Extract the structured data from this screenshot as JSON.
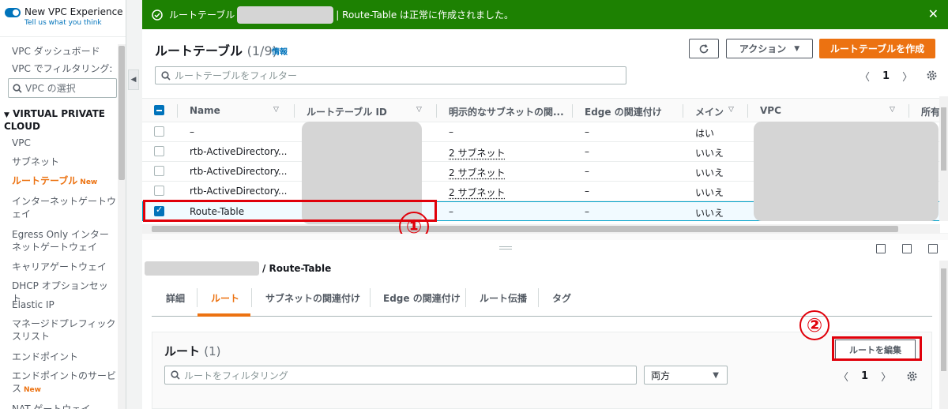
{
  "sidebar": {
    "new_vpc_title": "New VPC Experience",
    "new_vpc_link": "Tell us what you think",
    "dashboard": "VPC ダッシュボード",
    "filter_label": "VPC でフィルタリング:",
    "filter_placeholder": "VPC の選択",
    "section_title": "VIRTUAL PRIVATE CLOUD",
    "items": [
      {
        "label": "VPC"
      },
      {
        "label": "サブネット"
      },
      {
        "label": "ルートテーブル",
        "badge": "New"
      },
      {
        "label": "インターネットゲートウェイ"
      },
      {
        "label": "Egress Only インターネットゲートウェイ"
      },
      {
        "label": "キャリアゲートウェイ"
      },
      {
        "label": "DHCP オプションセット"
      },
      {
        "label": "Elastic IP"
      },
      {
        "label": "マネージドプレフィックスリスト"
      },
      {
        "label": "エンドポイント"
      },
      {
        "label": "エンドポイントのサービス",
        "badge": "New"
      },
      {
        "label": "NAT ゲートウェイ"
      }
    ]
  },
  "banner": {
    "prefix": "ルートテーブル",
    "suffix": "| Route-Table は正常に作成されました。"
  },
  "header": {
    "title": "ルートテーブル",
    "count": "(1/9)",
    "info": "情報",
    "actions_label": "アクション",
    "create_label": "ルートテーブルを作成",
    "filter_placeholder": "ルートテーブルをフィルター",
    "page": "1"
  },
  "table": {
    "columns": [
      "Name",
      "ルートテーブル ID",
      "明示的なサブネットの関...",
      "Edge の関連付け",
      "メイン",
      "VPC",
      "所有"
    ],
    "rows": [
      {
        "name": "–",
        "subnet": "–",
        "edge": "–",
        "main": "はい",
        "selected": false
      },
      {
        "name": "rtb-ActiveDirectory...",
        "subnet": "2 サブネット",
        "edge": "–",
        "main": "いいえ",
        "selected": false
      },
      {
        "name": "rtb-ActiveDirectory...",
        "subnet": "2 サブネット",
        "edge": "–",
        "main": "いいえ",
        "selected": false
      },
      {
        "name": "rtb-ActiveDirectory...",
        "subnet": "2 サブネット",
        "edge": "–",
        "main": "いいえ",
        "selected": false
      },
      {
        "name": "Route-Table",
        "subnet": "–",
        "edge": "–",
        "main": "いいえ",
        "selected": true
      }
    ]
  },
  "detail": {
    "breadcrumb": "/ Route-Table",
    "tabs": [
      "詳細",
      "ルート",
      "サブネットの関連付け",
      "Edge の関連付け",
      "ルート伝播",
      "タグ"
    ],
    "routes_title": "ルート",
    "routes_count": "(1)",
    "edit_label": "ルートを編集",
    "filter_placeholder": "ルートをフィルタリング",
    "select_value": "両方",
    "page": "1"
  },
  "annotations": {
    "one": "①",
    "two": "②"
  },
  "colors": {
    "success": "#1d8102",
    "accent": "#ec7211",
    "link": "#0073bb",
    "highlight": "#e0000a"
  }
}
